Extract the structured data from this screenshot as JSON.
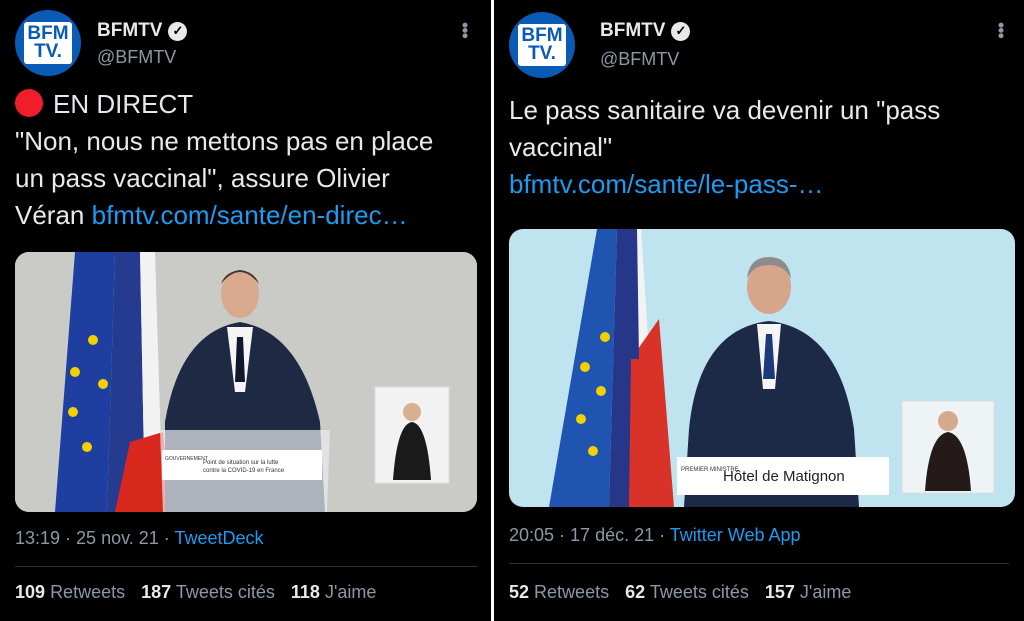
{
  "left": {
    "account_name": "BFMTV",
    "handle": "@BFMTV",
    "logo_line1": "BFM",
    "logo_line2": "TV.",
    "live_label": "EN DIRECT",
    "text_line1": "\"Non, nous ne mettons pas en place",
    "text_line2": "un pass vaccinal\", assure Olivier",
    "text_line3": "Véran ",
    "link": "bfmtv.com/sante/en-direc…",
    "timestamp": "13:19 · 25 nov. 21 · ",
    "app": "TweetDeck",
    "retweets_count": "109",
    "retweets_label": "Retweets",
    "quotes_count": "187",
    "quotes_label": "Tweets cités",
    "likes_count": "118",
    "likes_label": "J'aime",
    "podium_text": "Point de situation sur la lutte contre la COVID-19 en France",
    "podium_org": "GOUVERNEMENT"
  },
  "right": {
    "account_name": "BFMTV",
    "handle": "@BFMTV",
    "logo_line1": "BFM",
    "logo_line2": "TV.",
    "text_line1": "Le pass sanitaire va devenir un \"pass",
    "text_line2": "vaccinal\"",
    "link": "bfmtv.com/sante/le-pass-…",
    "timestamp": "20:05 · 17 déc. 21 · ",
    "app": "Twitter Web App",
    "retweets_count": "52",
    "retweets_label": "Retweets",
    "quotes_count": "62",
    "quotes_label": "Tweets cités",
    "likes_count": "157",
    "likes_label": "J'aime",
    "podium_text": "Hôtel de Matignon",
    "podium_org": "PREMIER MINISTRE"
  },
  "icons": {
    "verified": "verified-badge-icon",
    "more": "more-vertical-icon",
    "live": "red-dot-icon"
  }
}
